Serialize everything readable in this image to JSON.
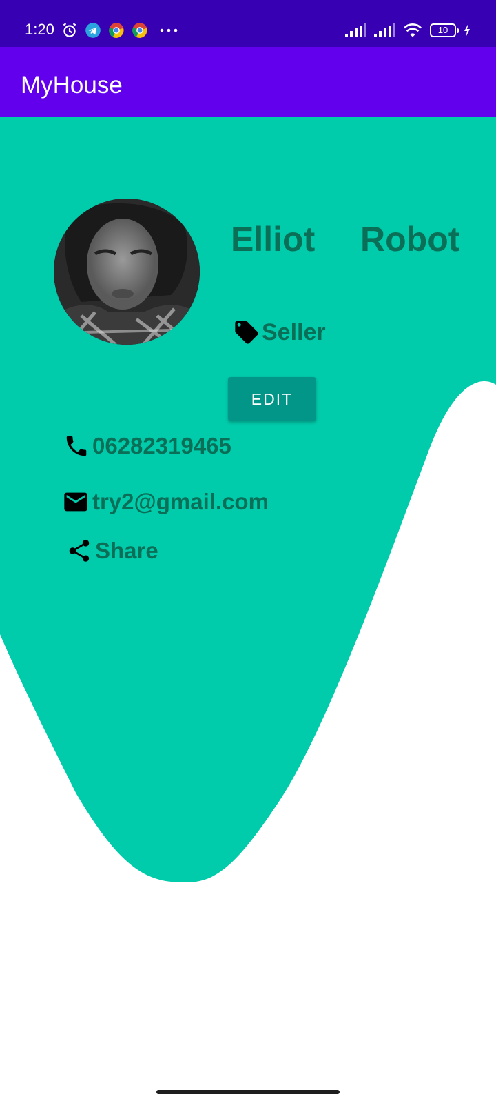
{
  "status_bar": {
    "time": "1:20",
    "battery": "10",
    "icons_left": [
      "alarm-icon",
      "telegram-icon",
      "chrome-icon",
      "chrome-icon",
      "more-icon"
    ],
    "icons_right": [
      "signal-icon",
      "signal-icon",
      "wifi-icon",
      "battery-icon",
      "charging-icon"
    ]
  },
  "app_bar": {
    "title": "MyHouse"
  },
  "profile": {
    "first_name": "Elliot",
    "last_name": "Robot",
    "role": "Seller",
    "edit_label": "EDIT",
    "phone": "06282319465",
    "email": "try2@gmail.com",
    "share_label": "Share"
  },
  "colors": {
    "status_bar": "#3700b3",
    "app_bar": "#6200ee",
    "background_shape": "#00cbab",
    "button": "#019688",
    "text_accent": "#0b6e57"
  }
}
